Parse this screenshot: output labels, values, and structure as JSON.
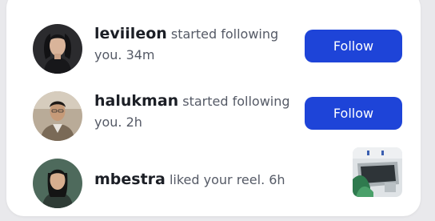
{
  "notifications": [
    {
      "username": "leviileon",
      "action": "started following",
      "time_line": "you. 34m",
      "button_label": "Follow",
      "avatar_icon": "person-avatar"
    },
    {
      "username": "halukman",
      "action": "started following",
      "time_line": "you. 2h",
      "button_label": "Follow",
      "avatar_icon": "person-avatar"
    },
    {
      "username": "mbestra",
      "action": "liked your reel.",
      "time": "6h",
      "thumbnail_icon": "reel-thumbnail",
      "avatar_icon": "person-avatar"
    }
  ],
  "colors": {
    "accent": "#1e44d8",
    "card": "#ffffff",
    "background": "#e9e9ec",
    "username": "#1c1f26",
    "secondary_text": "#555a66"
  }
}
